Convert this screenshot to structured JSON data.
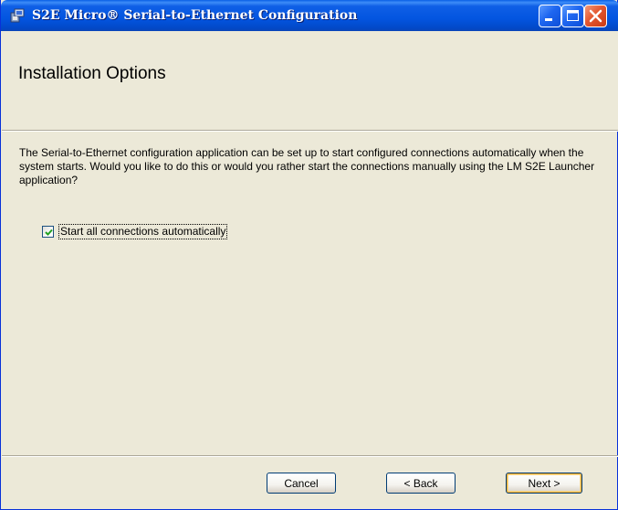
{
  "window": {
    "title": "S2E Micro® Serial-to-Ethernet Configuration",
    "controls": [
      "minimize-icon",
      "maximize-icon",
      "close-icon"
    ]
  },
  "header": {
    "title": "Installation Options"
  },
  "body": {
    "description": "The Serial-to-Ethernet configuration application can be set up to start configured connections automatically when the system starts. Would you like to do this or would you rather start the connections manually using the LM S2E Launcher application?",
    "checkbox": {
      "label": "Start all connections automatically",
      "checked": true
    }
  },
  "footer": {
    "cancel_label": "Cancel",
    "back_label": "< Back",
    "next_label": "Next >"
  },
  "colors": {
    "titlebar": "#0355e0",
    "background": "#ece9d8",
    "close_button": "#e4562f",
    "checkmark": "#21a121",
    "default_button_highlight": "#f8b030"
  }
}
